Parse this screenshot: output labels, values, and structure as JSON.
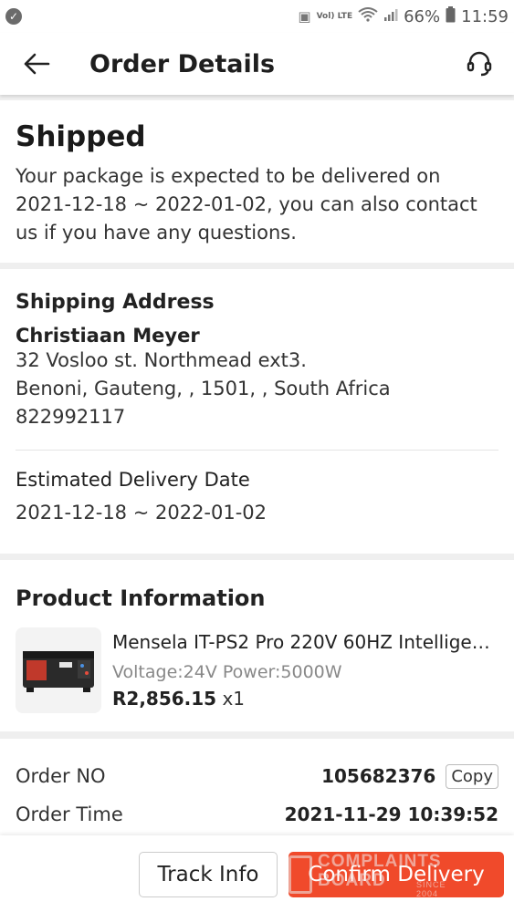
{
  "status_bar": {
    "lte_label": "Vol) LTE",
    "battery": "66%",
    "time": "11:59"
  },
  "header": {
    "title": "Order Details"
  },
  "order_status": {
    "title": "Shipped",
    "message": "Your package is expected to be delivered on 2021-12-18 ~ 2022-01-02, you can also contact us if you have any questions."
  },
  "shipping": {
    "title": "Shipping Address",
    "name": "Christiaan Meyer",
    "address_line1": "32 Vosloo st.  Northmead ext3.",
    "address_line2": "Benoni, Gauteng, , 1501, , South Africa",
    "phone": "822992117",
    "delivery_title": "Estimated Delivery Date",
    "delivery_date": "2021-12-18 ~ 2022-01-02"
  },
  "product": {
    "title": "Product Information",
    "name": "Mensela IT-PS2 Pro 220V 60HZ Intelligent...",
    "variant": "Voltage:24V Power:5000W",
    "price": "R2,856.15",
    "quantity": "x1"
  },
  "order_info": {
    "order_no_label": "Order NO",
    "order_no": "105682376",
    "copy_label": "Copy",
    "order_time_label": "Order Time",
    "order_time": "2021-11-29 10:39:52"
  },
  "actions": {
    "track_label": "Track Info",
    "confirm_label": "Confirm Delivery"
  },
  "watermark": {
    "line1": "COMPLAINTS",
    "line2": "BOARD",
    "line3": "SINCE 2004"
  },
  "colors": {
    "accent": "#f04a2b"
  }
}
